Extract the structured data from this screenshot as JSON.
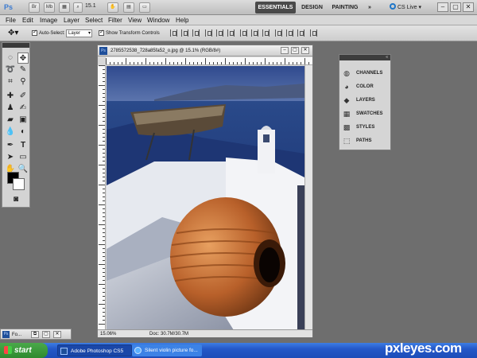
{
  "appbar": {
    "logo": "Ps",
    "zoom": "15.1",
    "workspaces": [
      "ESSENTIALS",
      "DESIGN",
      "PAINTING"
    ],
    "more": "»",
    "cs_live": "CS Live",
    "window_controls": [
      "–",
      "▢",
      "✕"
    ]
  },
  "menu": [
    "File",
    "Edit",
    "Image",
    "Layer",
    "Select",
    "Filter",
    "View",
    "Window",
    "Help"
  ],
  "options": {
    "auto_select_label": "Auto-Select:",
    "auto_select_value": "Layer",
    "transform_label": "Show Transform Controls"
  },
  "document": {
    "title": "2785572538_728a85fa52_o.jpg @ 15.1% (RGB/8#)",
    "zoom_status": "15.06%",
    "doc_size": "Doc: 30.7M/30.7M",
    "window_controls": [
      "–",
      "▢",
      "✕"
    ]
  },
  "panels": [
    {
      "label": "CHANNELS",
      "icon": "channels-icon"
    },
    {
      "label": "COLOR",
      "icon": "color-icon"
    },
    {
      "label": "LAYERS",
      "icon": "layers-icon"
    },
    {
      "label": "SWATCHES",
      "icon": "swatches-icon"
    },
    {
      "label": "STYLES",
      "icon": "styles-icon"
    },
    {
      "label": "PATHS",
      "icon": "paths-icon"
    }
  ],
  "minimized_doc": {
    "label": "Fo..."
  },
  "taskbar": {
    "start": "start",
    "items": [
      "Adobe Photoshop CS5",
      "Silent violin picture fo..."
    ]
  },
  "watermark": "pxleyes.com"
}
